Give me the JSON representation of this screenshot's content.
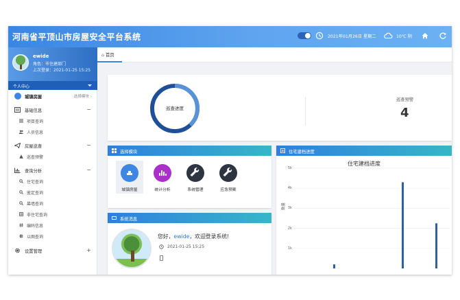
{
  "header": {
    "title": "河南省平顶山市房屋安全平台系统",
    "date": "2021年01月26日 星期二",
    "weather": "10℃ 阴"
  },
  "user": {
    "name": "ewide",
    "role": "角色：市住建部门",
    "last_login": "上次登录：2021-01-25 15:25",
    "personal_center": "个人中心"
  },
  "sidebar": {
    "city_module": {
      "label": "城镇房屋",
      "select": "选择模块 ›"
    },
    "groups": [
      {
        "label": "基础信息",
        "expand": "−",
        "items": [
          "项目查询",
          "人员信息"
        ]
      },
      {
        "label": "房屋巡查",
        "expand": "−",
        "items": [
          "巡查预警"
        ]
      },
      {
        "label": "查询分析",
        "expand": "−",
        "items": [
          "住宅查询",
          "鉴定查询",
          "幕墙查询",
          "非住宅查询",
          "编码信息",
          "以图查询"
        ]
      },
      {
        "label": "设置管理",
        "expand": "+",
        "items": []
      }
    ]
  },
  "tabs": {
    "home": "首页"
  },
  "progress": {
    "label": "巡查进度",
    "value": 0.62
  },
  "kpi": {
    "label": "巡查预警",
    "value": "4"
  },
  "modules": {
    "title": "选择模块",
    "items": [
      {
        "label": "城镇房屋",
        "color": "#3d86e4",
        "icon": "building-icon"
      },
      {
        "label": "统计分析",
        "color": "#a930c9",
        "icon": "bar-chart-icon"
      },
      {
        "label": "系统管理",
        "color": "#2e3440",
        "icon": "wrench-icon"
      },
      {
        "label": "应急预案",
        "color": "#2e3440",
        "icon": "wrench-icon"
      }
    ]
  },
  "message": {
    "title": "系统消息",
    "greet_pre": "您好，",
    "greet_user": "ewide",
    "greet_post": "，欢迎登录系统!",
    "time": "2021-01-25 15:25"
  },
  "chart_panel": {
    "title": "住宅建档进度"
  },
  "chart_data": {
    "type": "bar",
    "title": "住宅建档进度",
    "ylabel": "数量",
    "yticks": [
      "5k",
      "4k",
      "3k",
      "2k",
      "1k"
    ],
    "ylim": [
      0,
      5000
    ],
    "values": [
      200,
      4300,
      2250
    ],
    "grid": true
  },
  "colors": {
    "accent": "#3a86e3",
    "header_dark": "#1f5fb7",
    "donut": "#1f4f96",
    "donut_light": "#5a92d6"
  }
}
